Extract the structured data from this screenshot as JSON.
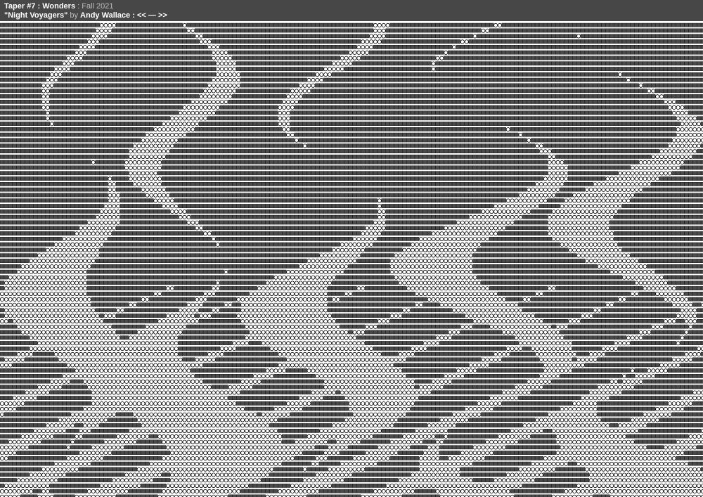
{
  "header": {
    "publication": "Taper #7",
    "sep1": " : ",
    "issue": "Wonders",
    "sep2": " : ",
    "season": "Fall 2021",
    "work_title": "\"Night Voyagers\"",
    "by": " by ",
    "author": "Andy Wallace",
    "sep3": " : ",
    "prev_label": "<<",
    "dash": " — ",
    "next_label": ">>"
  },
  "artwork": {
    "description_key": "ascii-pattern-grid",
    "colors": {
      "header_bg": "#474747",
      "header_text": "#ffffff",
      "header_muted": "#bdbdbd",
      "dark_cell": "#4a4a4a",
      "cell_border": "#000000",
      "light_cell": "#ffffff"
    }
  }
}
